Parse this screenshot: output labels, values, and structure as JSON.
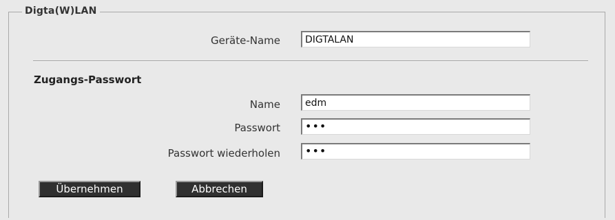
{
  "fieldset": {
    "legend": "Digta(W)LAN"
  },
  "device": {
    "name_label": "Geräte-Name",
    "name_value": "DIGTALAN"
  },
  "access": {
    "heading": "Zugangs-Passwort",
    "name_label": "Name",
    "name_value": "edm",
    "password_label": "Passwort",
    "password_mask": "•••",
    "password_repeat_label": "Passwort wiederholen",
    "password_repeat_mask": "•••"
  },
  "buttons": {
    "apply_label": "Übernehmen",
    "cancel_label": "Abbrechen"
  }
}
